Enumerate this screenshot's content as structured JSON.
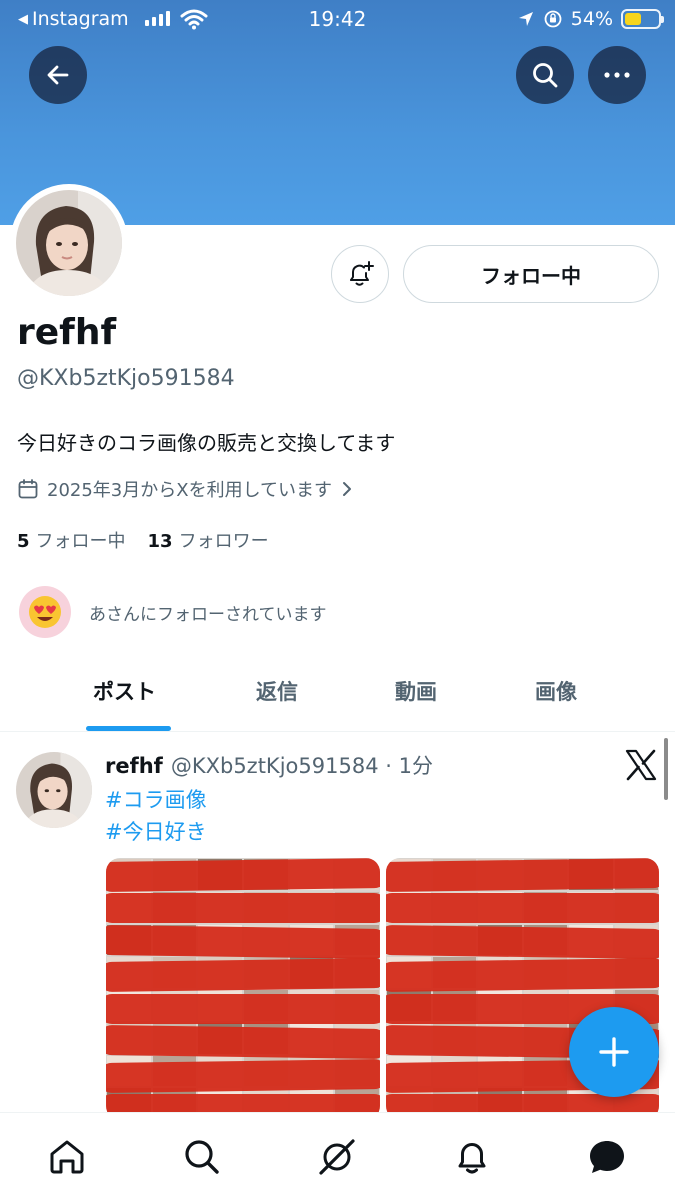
{
  "status_bar": {
    "back_app": "Instagram",
    "time": "19:42",
    "battery": "54%"
  },
  "header": {
    "back_icon": "arrow-left-icon",
    "search_icon": "search-icon",
    "more_icon": "more-icon"
  },
  "profile": {
    "name": "refhf",
    "handle": "@KXb5ztKjo591584",
    "bio": "今日好きのコラ画像の販売と交換してます",
    "joined": "2025年3月からXを利用しています",
    "following_count": "5",
    "following_label": "フォロー中",
    "followers_count": "13",
    "followers_label": "フォロワー",
    "followed_by": "あさんにフォローされています",
    "follow_button": "フォロー中"
  },
  "tabs": [
    {
      "label": "ポスト",
      "active": true
    },
    {
      "label": "返信",
      "active": false
    },
    {
      "label": "動画",
      "active": false
    },
    {
      "label": "画像",
      "active": false
    }
  ],
  "post": {
    "name": "refhf",
    "meta": "@KXb5ztKjo591584 · 1分",
    "hashtags": [
      "#コラ画像",
      "#今日好き"
    ]
  },
  "colors": {
    "accent": "#1d9bf0",
    "banner": "#4a95dc",
    "redaction": "#d42b1a"
  },
  "bottom_nav": [
    "home-icon",
    "search-icon",
    "grok-icon",
    "notifications-icon",
    "messages-icon"
  ]
}
